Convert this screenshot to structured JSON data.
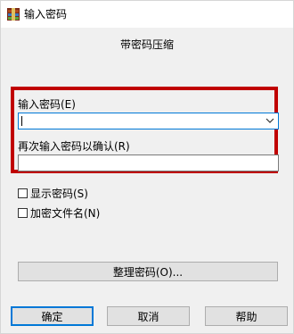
{
  "window": {
    "title": "输入密码",
    "icon": "archive-icon"
  },
  "heading": "带密码压缩",
  "password_field": {
    "label": "输入密码(E)",
    "value": ""
  },
  "confirm_field": {
    "label": "再次输入密码以确认(R)",
    "value": ""
  },
  "options": [
    {
      "label": "显示密码(S)",
      "checked": false
    },
    {
      "label": "加密文件名(N)",
      "checked": false
    }
  ],
  "buttons": {
    "organize": "整理密码(O)...",
    "ok": "确定",
    "cancel": "取消",
    "help": "帮助"
  },
  "colors": {
    "highlight": "#c00000",
    "focus": "#0078d7",
    "dialog_bg": "#f0f0f0"
  }
}
